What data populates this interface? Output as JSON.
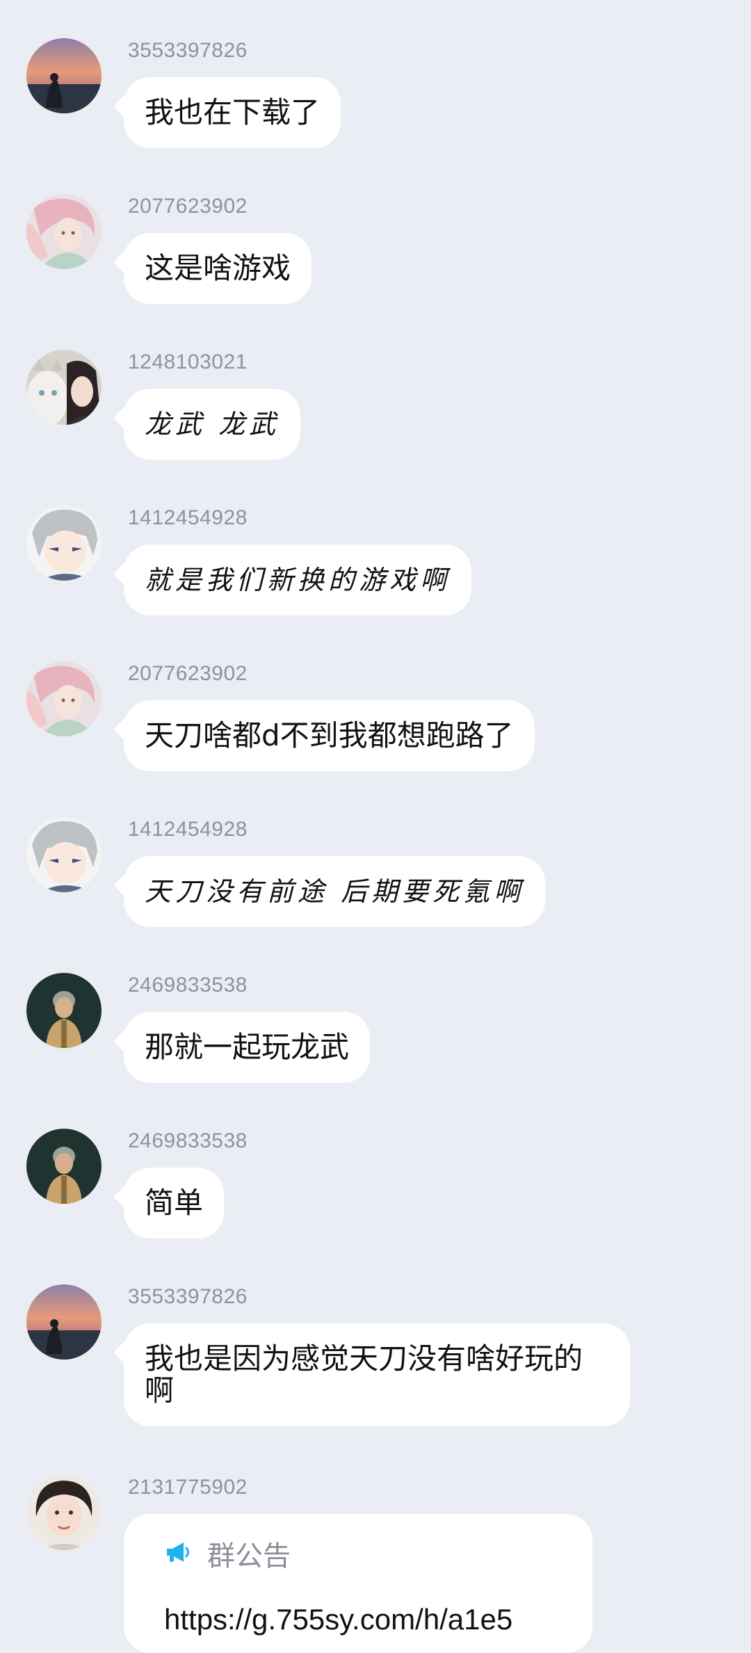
{
  "messages": [
    {
      "sender": "3553397826",
      "text": "我也在下载了"
    },
    {
      "sender": "2077623902",
      "text": "这是啥游戏"
    },
    {
      "sender": "1248103021",
      "text": "龙武 龙武"
    },
    {
      "sender": "1412454928",
      "text": "就是我们新换的游戏啊"
    },
    {
      "sender": "2077623902",
      "text": "天刀啥都d不到我都想跑路了"
    },
    {
      "sender": "1412454928",
      "text": "天刀没有前途  后期要死氪啊"
    },
    {
      "sender": "2469833538",
      "text": "那就一起玩龙武"
    },
    {
      "sender": "2469833538",
      "text": "简单"
    },
    {
      "sender": "3553397826",
      "text": "我也是因为感觉天刀没有啥好玩的啊"
    }
  ],
  "notice": {
    "sender": "2131775902",
    "title": "群公告",
    "icon": "megaphone-icon",
    "link": "https://g.755sy.com/h/a1e5"
  }
}
